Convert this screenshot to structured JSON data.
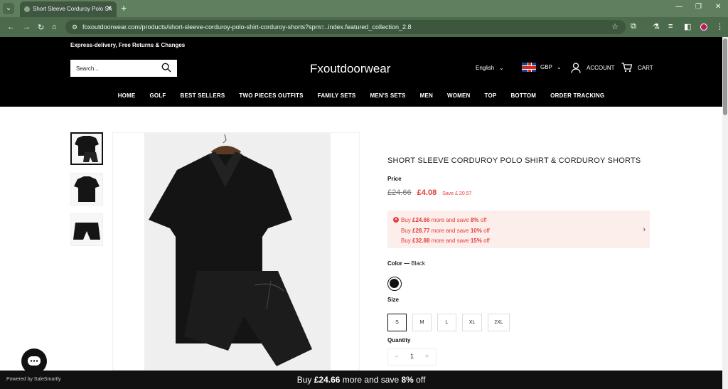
{
  "browser": {
    "tab_title": "Short Sleeve Corduroy Polo Sh",
    "url": "foxoutdoorwear.com/products/short-sleeve-corduroy-polo-shirt-corduroy-shorts?spm=..index.featured_collection_2.8"
  },
  "promo": {
    "text": "Express-delivery, Free Returns & Changes"
  },
  "header": {
    "search_placeholder": "Search...",
    "logo": "Fxoutdoorwear",
    "language": "English",
    "currency": "GBP",
    "account": "ACCOUNT",
    "cart": "CART"
  },
  "menu": [
    "HOME",
    "GOLF",
    "BEST SELLERS",
    "TWO PIECES OUTFITS",
    "FAMILY SETS",
    "MEN'S SETS",
    "MEN",
    "WOMEN",
    "TOP",
    "BOTTOM",
    "ORDER TRACKING"
  ],
  "product": {
    "title": "SHORT SLEEVE CORDUROY POLO SHIRT & CORDUROY SHORTS",
    "price_label": "Price",
    "old_price": "£24.66",
    "new_price": "£4.08",
    "save_text": "Save £ 20.57",
    "offers": [
      {
        "prefix": "Buy ",
        "amount": "£24.66",
        "middle": " more and save ",
        "pct": "8%",
        "suffix": " off"
      },
      {
        "prefix": "Buy ",
        "amount": "£28.77",
        "middle": " more and save ",
        "pct": "10%",
        "suffix": " off"
      },
      {
        "prefix": "Buy ",
        "amount": "£32.88",
        "middle": " more and save ",
        "pct": "15%",
        "suffix": " off"
      }
    ],
    "color_label": "Color — ",
    "color_value": "Black",
    "size_label": "Size",
    "sizes": [
      "S",
      "M",
      "L",
      "XL",
      "2XL"
    ],
    "selected_size": "S",
    "qty_label": "Quantity",
    "qty_value": "1"
  },
  "bottom": {
    "powered": "Powered by SaleSmartly",
    "prefix": "Buy ",
    "amount": "£24.66",
    "middle": " more and save ",
    "pct": "8%",
    "suffix": " off"
  },
  "colors": {
    "accent": "#e23b3b",
    "chrome": "#4c6b4c"
  }
}
